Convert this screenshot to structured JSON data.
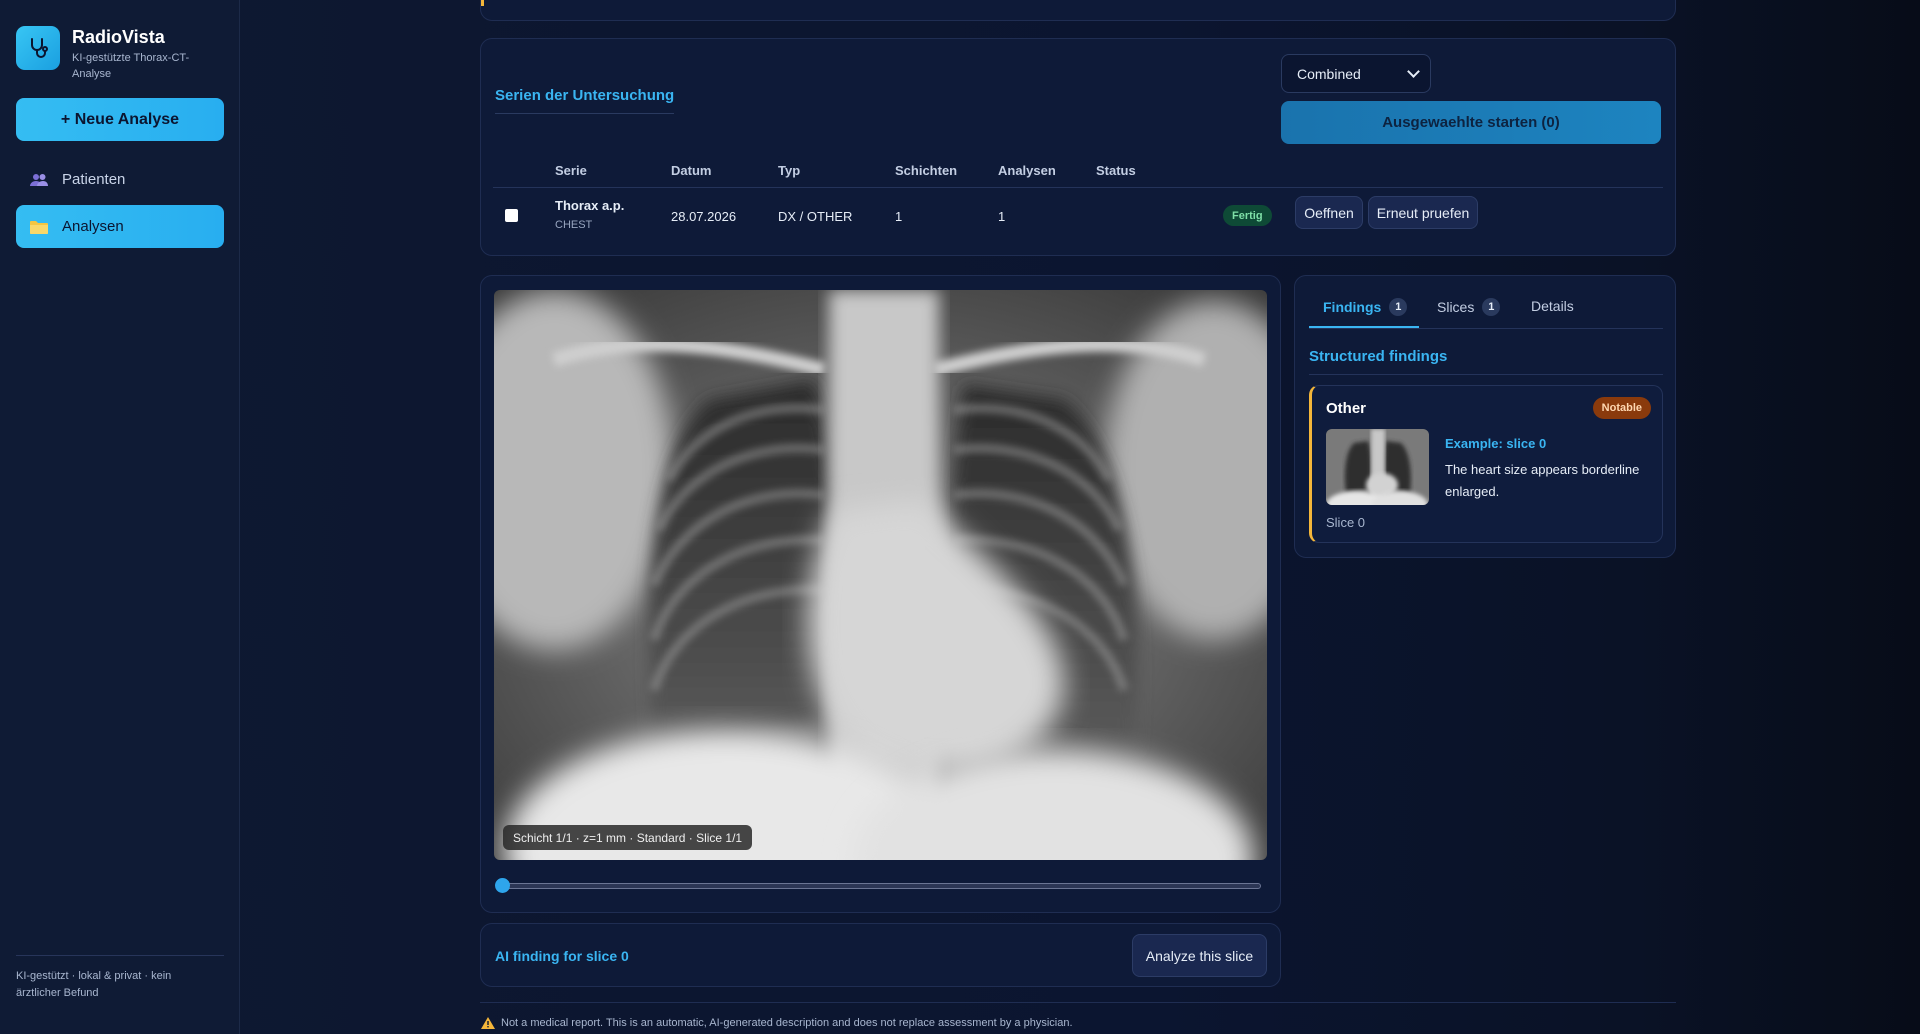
{
  "app": {
    "title": "RadioVista",
    "subtitle": "KI-gestützte Thorax-CT-Analyse"
  },
  "sidebar": {
    "new_button": "+ Neue Analyse",
    "items": [
      {
        "label": "Patienten",
        "icon": "users-icon",
        "active": false
      },
      {
        "label": "Analysen",
        "icon": "folder-icon",
        "active": true
      }
    ],
    "footer": "KI-gestützt · lokal & privat · kein ärztlicher Befund"
  },
  "series": {
    "title": "Serien der Untersuchung",
    "mode_select": {
      "value": "Combined"
    },
    "start_button": "Ausgewaehlte starten (0)",
    "columns": [
      "Serie",
      "Datum",
      "Typ",
      "Schichten",
      "Analysen",
      "Status"
    ],
    "rows": [
      {
        "name": "Thorax a.p.",
        "body_part": "CHEST",
        "date": "28.07.2026",
        "type": "DX / OTHER",
        "slices": "1",
        "analyses": "1",
        "status": "Fertig",
        "open_button": "Oeffnen",
        "recheck_button": "Erneut pruefen"
      }
    ]
  },
  "viewer": {
    "slice_label": "Schicht 1/1 · z=1 mm · Standard · Slice 1/1",
    "slider_position": 0
  },
  "ai_finding": {
    "title": "AI finding for slice 0",
    "button": "Analyze this slice"
  },
  "findings": {
    "tabs": [
      {
        "label": "Findings",
        "count": "1"
      },
      {
        "label": "Slices",
        "count": "1"
      },
      {
        "label": "Details",
        "count": ""
      }
    ],
    "structured_title": "Structured findings",
    "cards": [
      {
        "category": "Other",
        "severity": "Notable",
        "example_title": "Example: slice 0",
        "text": "The heart size appears borderline enlarged.",
        "slice_label": "Slice 0"
      }
    ]
  },
  "disclaimer": "Not a medical report. This is an automatic, AI-generated description and does not replace assessment by a physician.",
  "colors": {
    "accent": "#3ab5f2",
    "warning": "#f4b63a",
    "success_bg": "#0e4a36",
    "notable_bg": "#8a3a0c"
  }
}
